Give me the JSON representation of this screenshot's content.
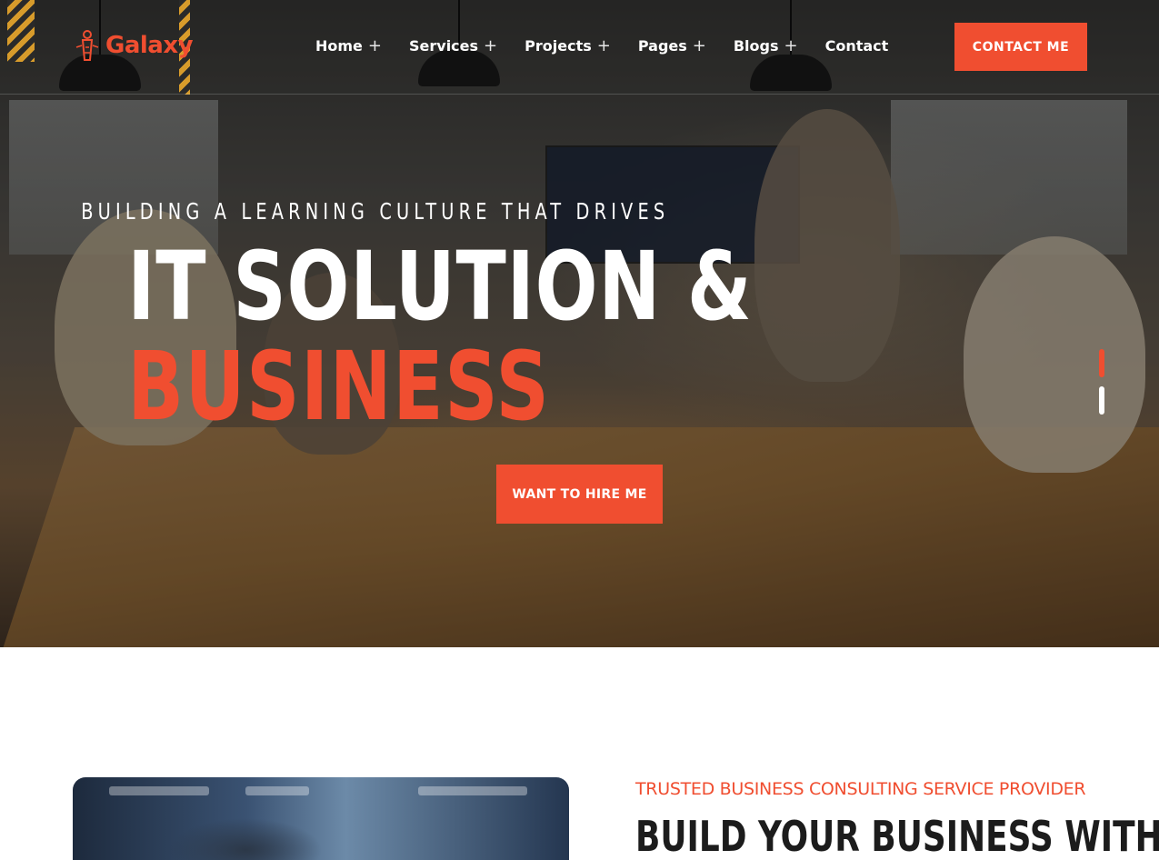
{
  "brand": {
    "name": "Galaxy",
    "accent": "#f04e30"
  },
  "nav": {
    "items": [
      {
        "label": "Home",
        "has_submenu": true
      },
      {
        "label": "Services",
        "has_submenu": true
      },
      {
        "label": "Projects",
        "has_submenu": true
      },
      {
        "label": "Pages",
        "has_submenu": true
      },
      {
        "label": "Blogs",
        "has_submenu": true
      },
      {
        "label": "Contact",
        "has_submenu": false
      }
    ],
    "submenu_icon": "+",
    "cta_label": "CONTACT ME"
  },
  "hero": {
    "subtitle": "BUILDING A LEARNING CULTURE THAT DRIVES",
    "title_line1": "IT SOLUTION &",
    "title_line2": "BUSINESS",
    "button_label": "WANT TO HIRE ME",
    "slides": {
      "count": 2,
      "active": 1
    }
  },
  "about": {
    "tagline": "TRUSTED BUSINESS CONSULTING SERVICE PROVIDER",
    "heading": "BUILD YOUR BUSINESS WITH"
  }
}
